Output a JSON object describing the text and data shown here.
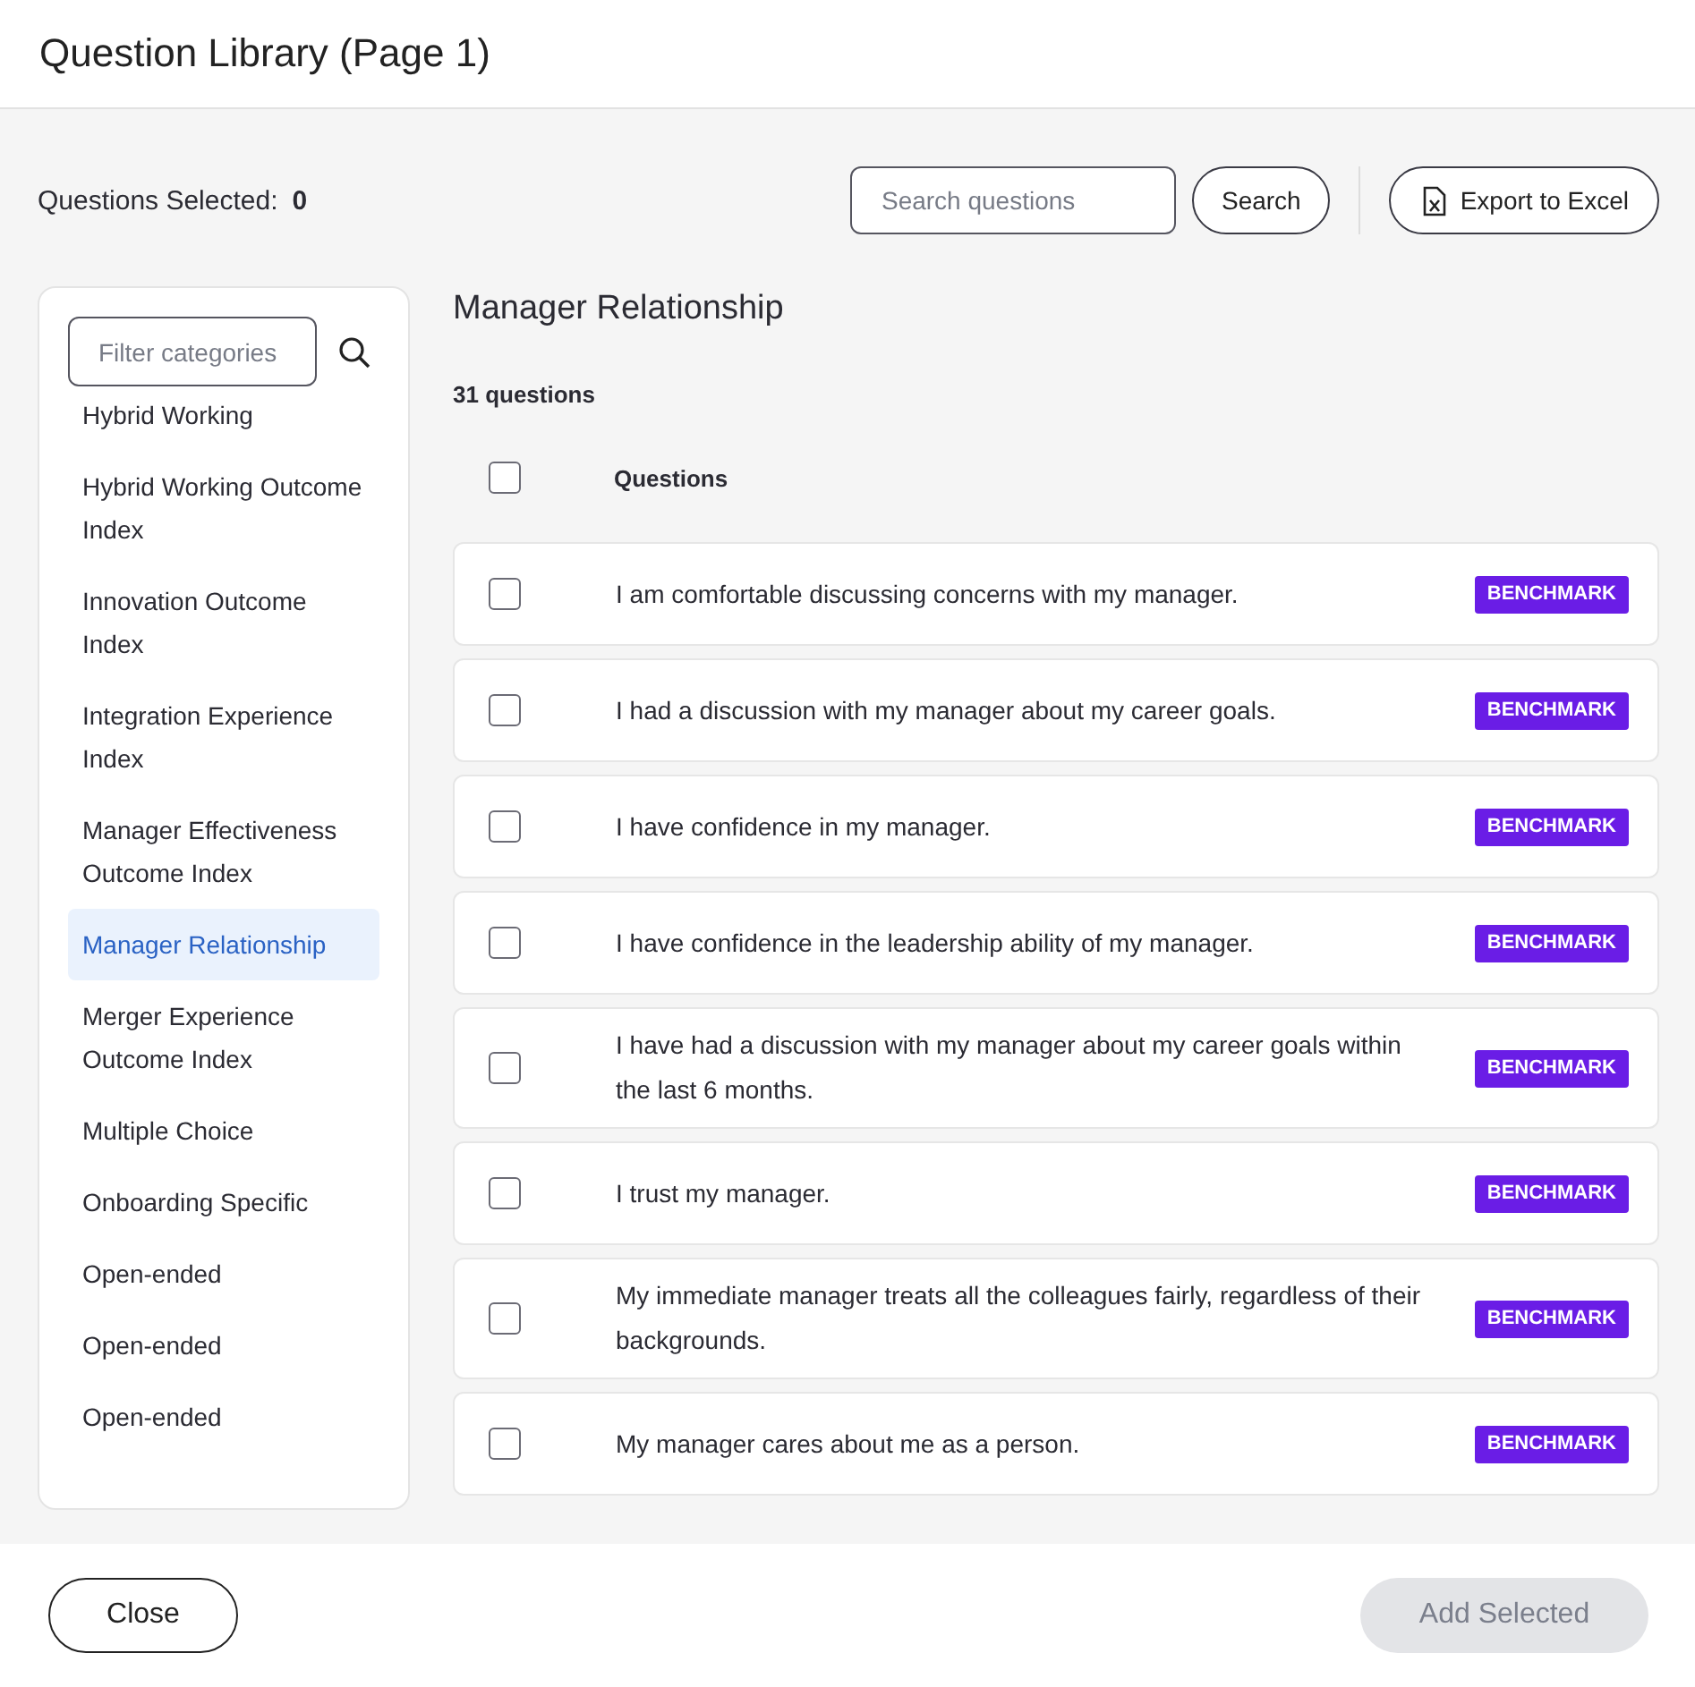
{
  "window": {
    "title": "Question Library (Page 1)"
  },
  "toolbar": {
    "selected_label": "Questions Selected:",
    "selected_count": "0",
    "search": {
      "placeholder": "Search questions"
    },
    "search_button": "Search",
    "export_button": "Export to Excel"
  },
  "sidebar": {
    "filter": {
      "placeholder": "Filter categories"
    },
    "items": [
      {
        "label": "Hybrid Working",
        "selected": false
      },
      {
        "label": "Hybrid Working Outcome Index",
        "selected": false
      },
      {
        "label": "Innovation Outcome Index",
        "selected": false
      },
      {
        "label": "Integration Experience Index",
        "selected": false
      },
      {
        "label": "Manager Effectiveness Outcome Index",
        "selected": false
      },
      {
        "label": "Manager Relationship",
        "selected": true
      },
      {
        "label": "Merger Experience Outcome Index",
        "selected": false
      },
      {
        "label": "Multiple Choice",
        "selected": false
      },
      {
        "label": "Onboarding Specific",
        "selected": false
      },
      {
        "label": "Open-ended",
        "selected": false
      },
      {
        "label": "Open-ended",
        "selected": false
      },
      {
        "label": "Open-ended",
        "selected": false
      }
    ]
  },
  "content": {
    "title": "Manager Relationship",
    "count": "31 questions",
    "header": {
      "label": "Questions",
      "checked": false
    },
    "rows": [
      {
        "text": "I am comfortable discussing concerns with my manager.",
        "checked": false,
        "badge": "BENCHMARK"
      },
      {
        "text": "I had a discussion with my manager about my career goals.",
        "checked": false,
        "badge": "BENCHMARK"
      },
      {
        "text": "I have confidence in my manager.",
        "checked": false,
        "badge": "BENCHMARK"
      },
      {
        "text": "I have confidence in the leadership ability of my manager.",
        "checked": false,
        "badge": "BENCHMARK"
      },
      {
        "text": "I have had a discussion with my manager about my career goals within the last 6 months.",
        "checked": false,
        "badge": "BENCHMARK"
      },
      {
        "text": "I trust my manager.",
        "checked": false,
        "badge": "BENCHMARK"
      },
      {
        "text": "My immediate manager treats all the colleagues fairly, regardless of their backgrounds.",
        "checked": false,
        "badge": "BENCHMARK"
      },
      {
        "text": "My manager cares about me as a person.",
        "checked": false,
        "badge": "BENCHMARK"
      }
    ]
  },
  "footer": {
    "close_button": "Close",
    "add_button": {
      "label": "Add Selected",
      "disabled": true
    }
  }
}
